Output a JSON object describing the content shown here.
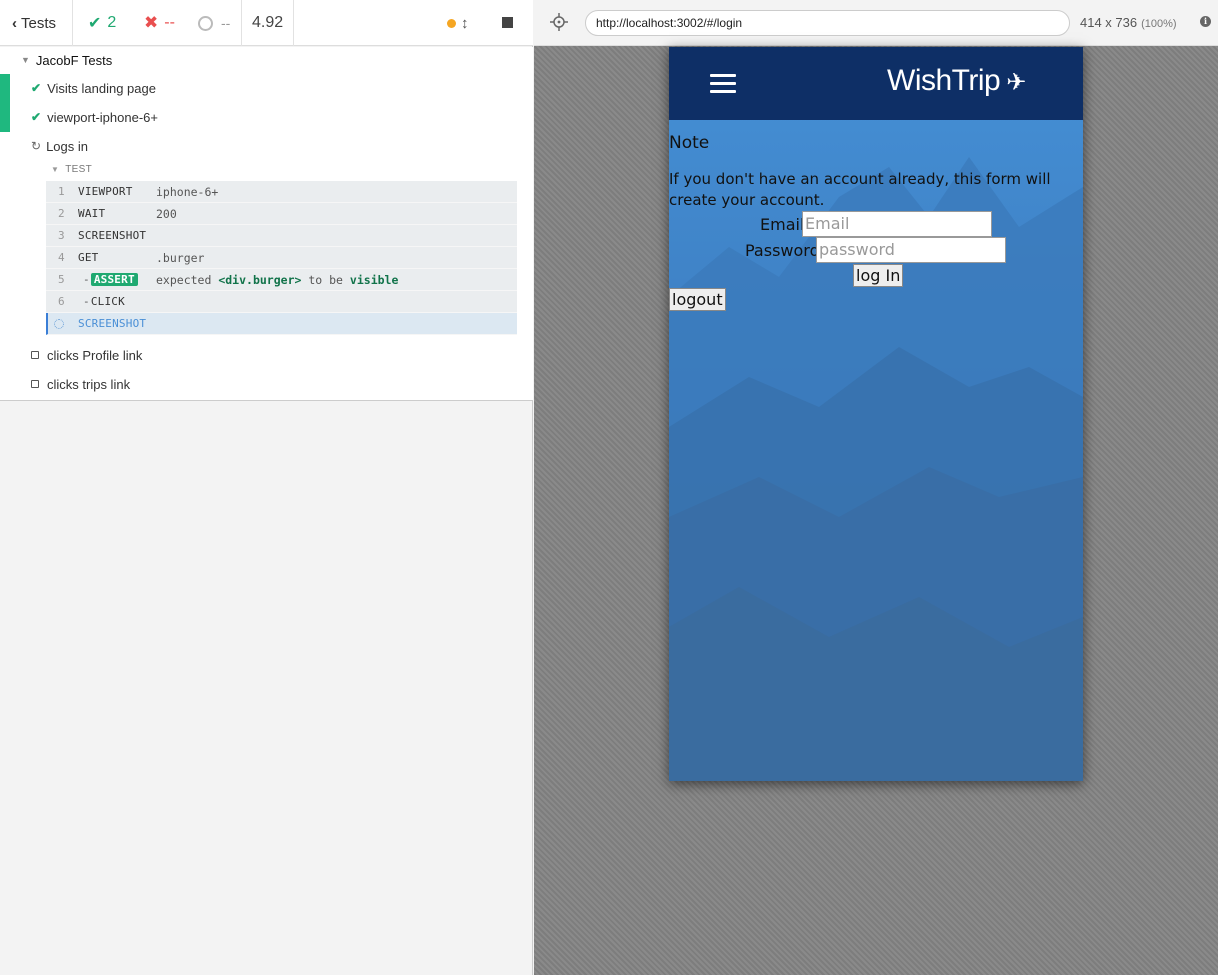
{
  "stats": {
    "back_label": "Tests",
    "passed": "2",
    "failed": "--",
    "pending": "--",
    "duration": "4.92"
  },
  "suite": {
    "title": "JacobF Tests",
    "tests": [
      {
        "title": "Visits landing page",
        "state": "passed"
      },
      {
        "title": "viewport-iphone-6+",
        "state": "passed"
      },
      {
        "title": "Logs in",
        "state": "running"
      },
      {
        "title": "clicks Profile link",
        "state": "pending"
      },
      {
        "title": "clicks trips link",
        "state": "pending"
      }
    ]
  },
  "command_log": {
    "header": "TEST",
    "commands": [
      {
        "num": "1",
        "name": "VIEWPORT",
        "message": "iphone-6+"
      },
      {
        "num": "2",
        "name": "WAIT",
        "message": "200"
      },
      {
        "num": "3",
        "name": "SCREENSHOT",
        "message": ""
      },
      {
        "num": "4",
        "name": "GET",
        "message": ".burger"
      },
      {
        "num": "5",
        "name": "ASSERT",
        "message_parts": [
          "expected",
          "<div.burger>",
          "to be",
          "visible"
        ]
      },
      {
        "num": "6",
        "name": "CLICK",
        "message": ""
      },
      {
        "num": "",
        "name": "SCREENSHOT",
        "message": "",
        "active": true
      }
    ]
  },
  "aut": {
    "url": "http://localhost:3002/#/login",
    "viewport": "414 x 736",
    "zoom": "(100%)",
    "info_glyph": "i"
  },
  "app": {
    "brand": "WishTrip",
    "plane_glyph": "✈",
    "note_title": "Note",
    "note_text": "If you don't have an account already, this form will create your account.",
    "email_label": "Email",
    "email_placeholder": "Email",
    "password_label": "Password",
    "password_placeholder": "password",
    "login_button": "log In",
    "logout_button": "logout"
  },
  "colors": {
    "pass": "#1fa971",
    "fail": "#e94f4f",
    "navbar": "#0e2f66",
    "app_bg": "#3d7ab8",
    "running_dot": "#f5a623"
  }
}
